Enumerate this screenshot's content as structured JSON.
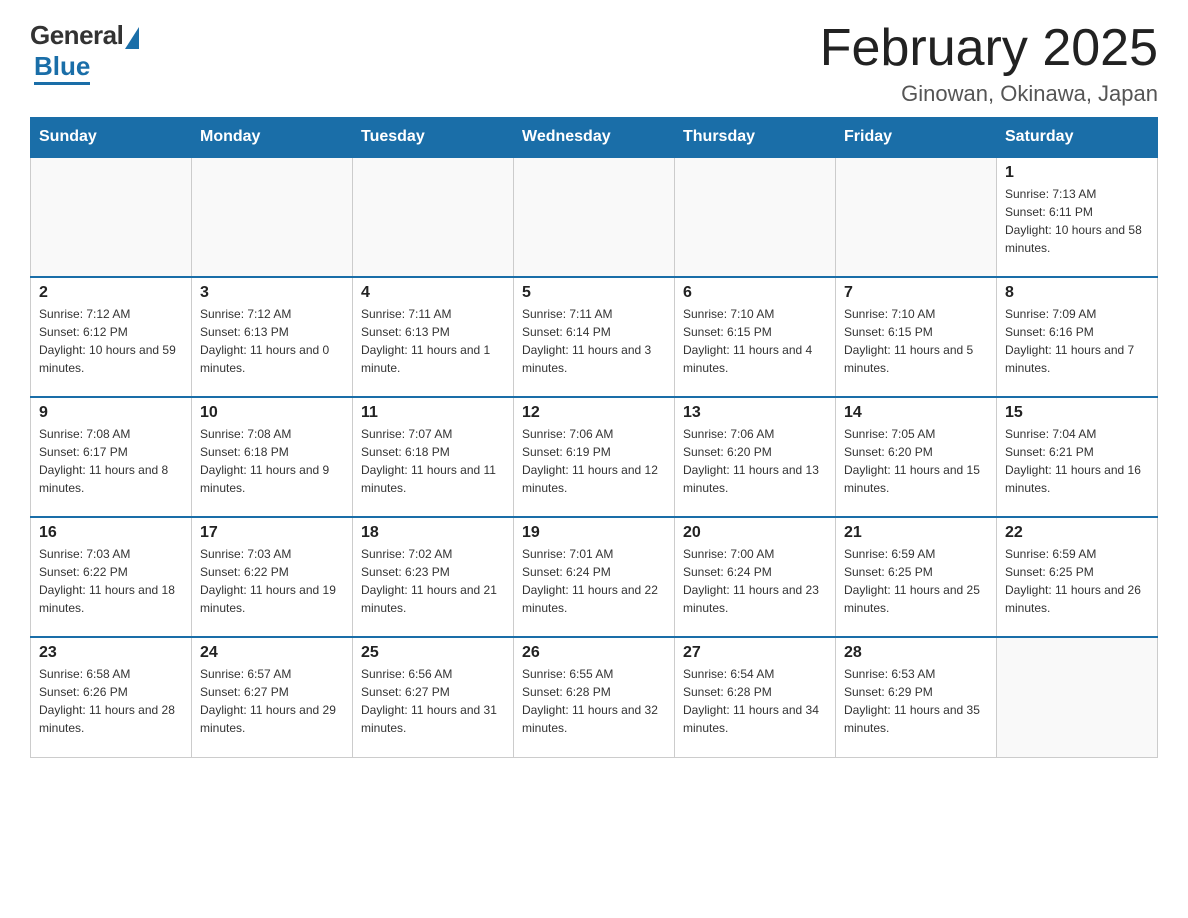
{
  "header": {
    "logo_general": "General",
    "logo_blue": "Blue",
    "month_title": "February 2025",
    "location": "Ginowan, Okinawa, Japan"
  },
  "weekdays": [
    "Sunday",
    "Monday",
    "Tuesday",
    "Wednesday",
    "Thursday",
    "Friday",
    "Saturday"
  ],
  "weeks": [
    [
      null,
      null,
      null,
      null,
      null,
      null,
      {
        "day": "1",
        "sunrise": "Sunrise: 7:13 AM",
        "sunset": "Sunset: 6:11 PM",
        "daylight": "Daylight: 10 hours and 58 minutes."
      }
    ],
    [
      {
        "day": "2",
        "sunrise": "Sunrise: 7:12 AM",
        "sunset": "Sunset: 6:12 PM",
        "daylight": "Daylight: 10 hours and 59 minutes."
      },
      {
        "day": "3",
        "sunrise": "Sunrise: 7:12 AM",
        "sunset": "Sunset: 6:13 PM",
        "daylight": "Daylight: 11 hours and 0 minutes."
      },
      {
        "day": "4",
        "sunrise": "Sunrise: 7:11 AM",
        "sunset": "Sunset: 6:13 PM",
        "daylight": "Daylight: 11 hours and 1 minute."
      },
      {
        "day": "5",
        "sunrise": "Sunrise: 7:11 AM",
        "sunset": "Sunset: 6:14 PM",
        "daylight": "Daylight: 11 hours and 3 minutes."
      },
      {
        "day": "6",
        "sunrise": "Sunrise: 7:10 AM",
        "sunset": "Sunset: 6:15 PM",
        "daylight": "Daylight: 11 hours and 4 minutes."
      },
      {
        "day": "7",
        "sunrise": "Sunrise: 7:10 AM",
        "sunset": "Sunset: 6:15 PM",
        "daylight": "Daylight: 11 hours and 5 minutes."
      },
      {
        "day": "8",
        "sunrise": "Sunrise: 7:09 AM",
        "sunset": "Sunset: 6:16 PM",
        "daylight": "Daylight: 11 hours and 7 minutes."
      }
    ],
    [
      {
        "day": "9",
        "sunrise": "Sunrise: 7:08 AM",
        "sunset": "Sunset: 6:17 PM",
        "daylight": "Daylight: 11 hours and 8 minutes."
      },
      {
        "day": "10",
        "sunrise": "Sunrise: 7:08 AM",
        "sunset": "Sunset: 6:18 PM",
        "daylight": "Daylight: 11 hours and 9 minutes."
      },
      {
        "day": "11",
        "sunrise": "Sunrise: 7:07 AM",
        "sunset": "Sunset: 6:18 PM",
        "daylight": "Daylight: 11 hours and 11 minutes."
      },
      {
        "day": "12",
        "sunrise": "Sunrise: 7:06 AM",
        "sunset": "Sunset: 6:19 PM",
        "daylight": "Daylight: 11 hours and 12 minutes."
      },
      {
        "day": "13",
        "sunrise": "Sunrise: 7:06 AM",
        "sunset": "Sunset: 6:20 PM",
        "daylight": "Daylight: 11 hours and 13 minutes."
      },
      {
        "day": "14",
        "sunrise": "Sunrise: 7:05 AM",
        "sunset": "Sunset: 6:20 PM",
        "daylight": "Daylight: 11 hours and 15 minutes."
      },
      {
        "day": "15",
        "sunrise": "Sunrise: 7:04 AM",
        "sunset": "Sunset: 6:21 PM",
        "daylight": "Daylight: 11 hours and 16 minutes."
      }
    ],
    [
      {
        "day": "16",
        "sunrise": "Sunrise: 7:03 AM",
        "sunset": "Sunset: 6:22 PM",
        "daylight": "Daylight: 11 hours and 18 minutes."
      },
      {
        "day": "17",
        "sunrise": "Sunrise: 7:03 AM",
        "sunset": "Sunset: 6:22 PM",
        "daylight": "Daylight: 11 hours and 19 minutes."
      },
      {
        "day": "18",
        "sunrise": "Sunrise: 7:02 AM",
        "sunset": "Sunset: 6:23 PM",
        "daylight": "Daylight: 11 hours and 21 minutes."
      },
      {
        "day": "19",
        "sunrise": "Sunrise: 7:01 AM",
        "sunset": "Sunset: 6:24 PM",
        "daylight": "Daylight: 11 hours and 22 minutes."
      },
      {
        "day": "20",
        "sunrise": "Sunrise: 7:00 AM",
        "sunset": "Sunset: 6:24 PM",
        "daylight": "Daylight: 11 hours and 23 minutes."
      },
      {
        "day": "21",
        "sunrise": "Sunrise: 6:59 AM",
        "sunset": "Sunset: 6:25 PM",
        "daylight": "Daylight: 11 hours and 25 minutes."
      },
      {
        "day": "22",
        "sunrise": "Sunrise: 6:59 AM",
        "sunset": "Sunset: 6:25 PM",
        "daylight": "Daylight: 11 hours and 26 minutes."
      }
    ],
    [
      {
        "day": "23",
        "sunrise": "Sunrise: 6:58 AM",
        "sunset": "Sunset: 6:26 PM",
        "daylight": "Daylight: 11 hours and 28 minutes."
      },
      {
        "day": "24",
        "sunrise": "Sunrise: 6:57 AM",
        "sunset": "Sunset: 6:27 PM",
        "daylight": "Daylight: 11 hours and 29 minutes."
      },
      {
        "day": "25",
        "sunrise": "Sunrise: 6:56 AM",
        "sunset": "Sunset: 6:27 PM",
        "daylight": "Daylight: 11 hours and 31 minutes."
      },
      {
        "day": "26",
        "sunrise": "Sunrise: 6:55 AM",
        "sunset": "Sunset: 6:28 PM",
        "daylight": "Daylight: 11 hours and 32 minutes."
      },
      {
        "day": "27",
        "sunrise": "Sunrise: 6:54 AM",
        "sunset": "Sunset: 6:28 PM",
        "daylight": "Daylight: 11 hours and 34 minutes."
      },
      {
        "day": "28",
        "sunrise": "Sunrise: 6:53 AM",
        "sunset": "Sunset: 6:29 PM",
        "daylight": "Daylight: 11 hours and 35 minutes."
      },
      null
    ]
  ]
}
